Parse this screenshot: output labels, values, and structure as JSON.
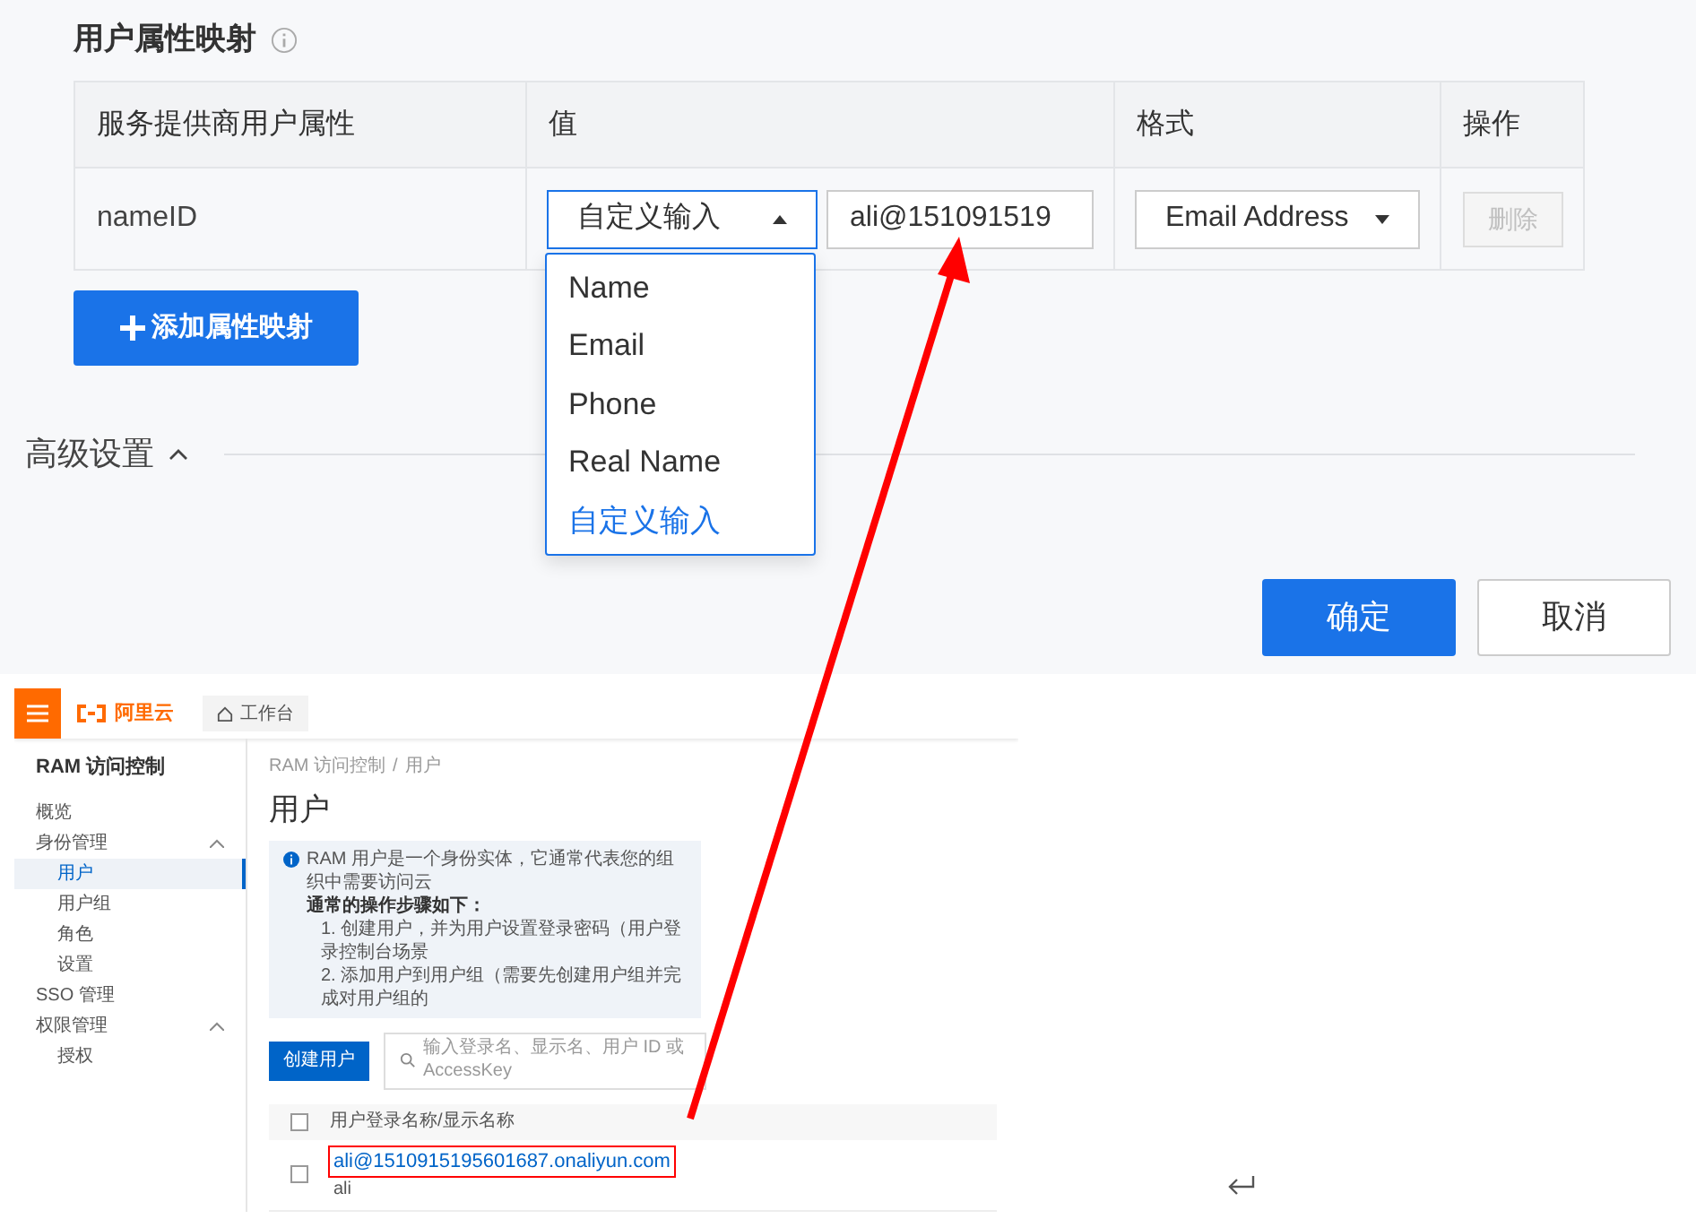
{
  "section_title": "用户属性映射",
  "table": {
    "columns": [
      "服务提供商用户属性",
      "值",
      "格式",
      "操作"
    ],
    "rows": [
      {
        "attribute": "nameID",
        "value_select": "自定义输入",
        "value_input": "ali@151091519",
        "format_select": "Email Address",
        "action_button": {
          "label": "删除",
          "disabled": true
        }
      }
    ]
  },
  "dropdown": {
    "expanded": true,
    "options": [
      {
        "label": "Name",
        "selected": false
      },
      {
        "label": "Email",
        "selected": false
      },
      {
        "label": "Phone",
        "selected": false
      },
      {
        "label": "Real Name",
        "selected": false
      },
      {
        "label": "自定义输入",
        "selected": true
      }
    ]
  },
  "add_button": "添加属性映射",
  "advanced": {
    "label": "高级设置",
    "expanded": true
  },
  "footer_buttons": [
    {
      "label": "确定",
      "kind": "primary"
    },
    {
      "label": "取消",
      "kind": "default"
    }
  ],
  "inset": {
    "logo": "阿里云",
    "workbench": "工作台",
    "sidebar_title": "RAM 访问控制",
    "sidebar_items": [
      {
        "label": "概览",
        "selected": false
      },
      {
        "label": "身份管理",
        "expanded": true,
        "children": [
          {
            "label": "用户",
            "selected": true
          },
          {
            "label": "用户组",
            "selected": false
          },
          {
            "label": "角色",
            "selected": false
          },
          {
            "label": "设置",
            "selected": false
          }
        ]
      },
      {
        "label": "SSO 管理",
        "selected": false
      },
      {
        "label": "权限管理",
        "expanded": true,
        "children": [
          {
            "label": "授权",
            "selected": false
          }
        ]
      }
    ],
    "breadcrumb": [
      "RAM 访问控制",
      "用户"
    ],
    "breadcrumb_separator": "/",
    "select_all_checked": false,
    "page_title": "用户",
    "info_lines": [
      {
        "text": "RAM 用户是一个身份实体，它通常代表您的组织中需要访问云",
        "kind": "lead"
      },
      {
        "text": "通常的操作步骤如下：",
        "kind": "heading"
      },
      {
        "text": "1. 创建用户，并为用户设置登录密码（用户登录控制台场景",
        "kind": "step"
      },
      {
        "text": "2. 添加用户到用户组（需要先创建用户组并完成对用户组的",
        "kind": "step"
      }
    ],
    "create_button": "创建用户",
    "search_placeholder": "输入登录名、显示名、用户 ID 或 AccessKey",
    "column": "用户登录名称/显示名称",
    "rows": [
      {
        "login_name": "ali@1510915195601687.onaliyun.com",
        "display_name": "ali",
        "checked": false,
        "highlighted": true
      }
    ]
  }
}
